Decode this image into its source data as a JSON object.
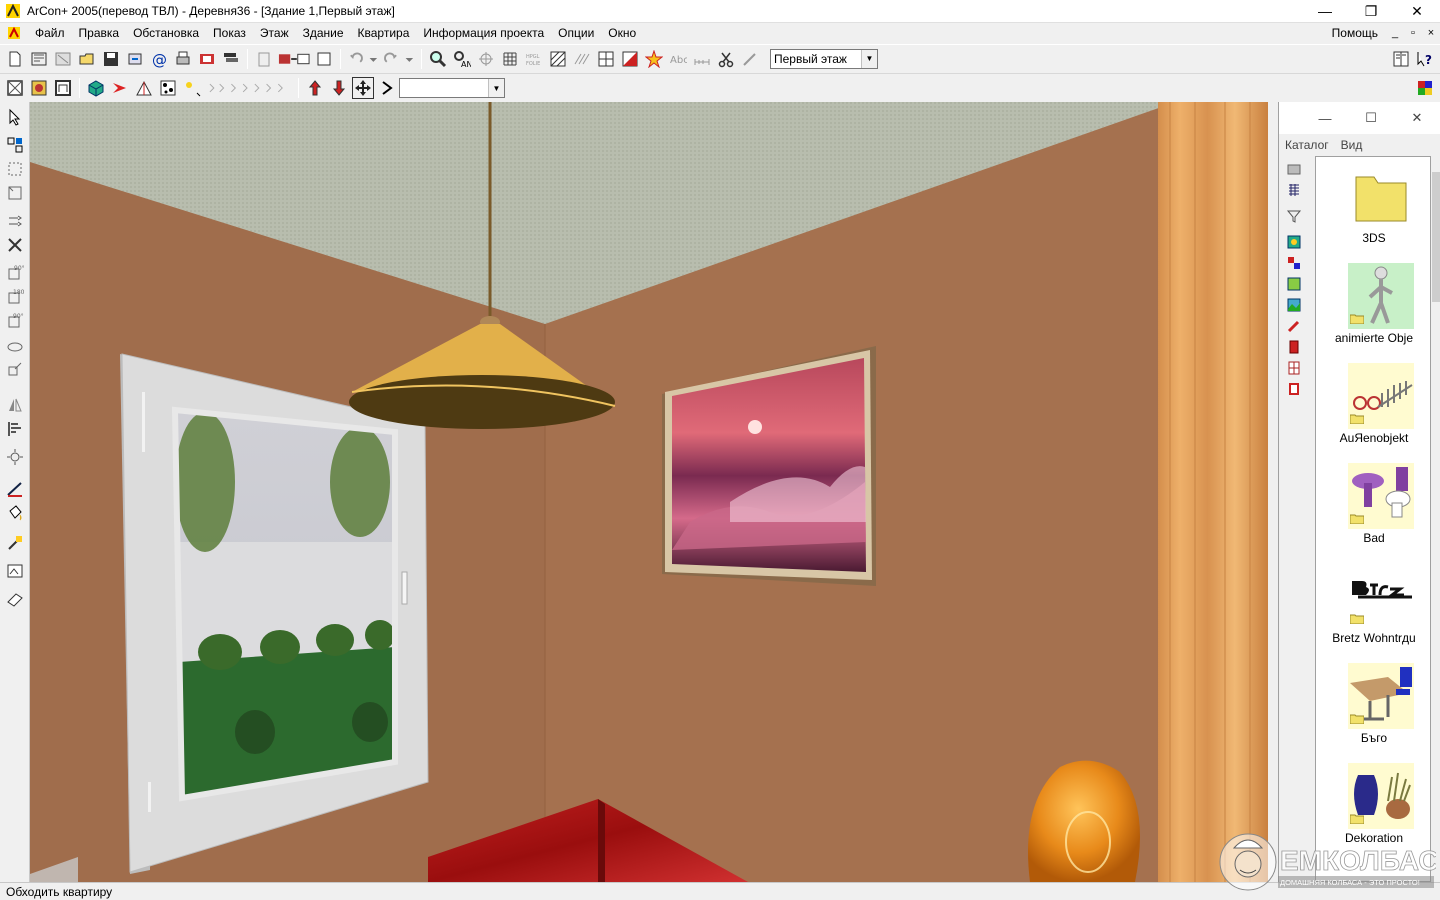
{
  "window": {
    "title": "ArCon+  2005(перевод ТВЛ)  - Деревня36 - [Здание 1,Первый этаж]",
    "min_glyph": "—",
    "max_glyph": "❐",
    "close_glyph": "✕"
  },
  "menu": {
    "items": [
      "Файл",
      "Правка",
      "Обстановка",
      "Показ",
      "Этаж",
      "Здание",
      "Квартира",
      "Информация проекта",
      "Опции",
      "Окно"
    ],
    "help": "Помощь",
    "mdi_min": "_",
    "mdi_restore": "▫",
    "mdi_close": "×"
  },
  "toolbar": {
    "floor_combo": "Первый этаж",
    "second_combo": ""
  },
  "catalog": {
    "window_min": "—",
    "window_max": "☐",
    "window_close": "✕",
    "menu": [
      "Каталог",
      "Вид"
    ],
    "items": [
      {
        "label": "3DS",
        "thumb": "folder-icon"
      },
      {
        "label": "animierte Obje",
        "thumb": "animated-figure-thumb"
      },
      {
        "label": "AuЯenobjekt",
        "thumb": "outdoor-objects-thumb"
      },
      {
        "label": "Bad",
        "thumb": "bathroom-thumb"
      },
      {
        "label": "Bretz Wohntrдu",
        "thumb": "bretz-logo-thumb"
      },
      {
        "label": "Бъго",
        "thumb": "office-desk-thumb"
      },
      {
        "label": "Dekoration",
        "thumb": "vases-thumb"
      }
    ]
  },
  "status": {
    "text": "Обходить квартиру"
  },
  "watermark": {
    "text": "ЕМКОЛБАСКИ",
    "subtext": "ДОМАШНЯЯ КОЛБАСА - ЭТО ПРОСТО!"
  },
  "colors": {
    "wall": "#a5714f",
    "ceiling": "#b7bcae",
    "lamp_shade": "#e2b04a",
    "window_frame": "#dcdcdc",
    "curtain": "#e6a35e"
  }
}
